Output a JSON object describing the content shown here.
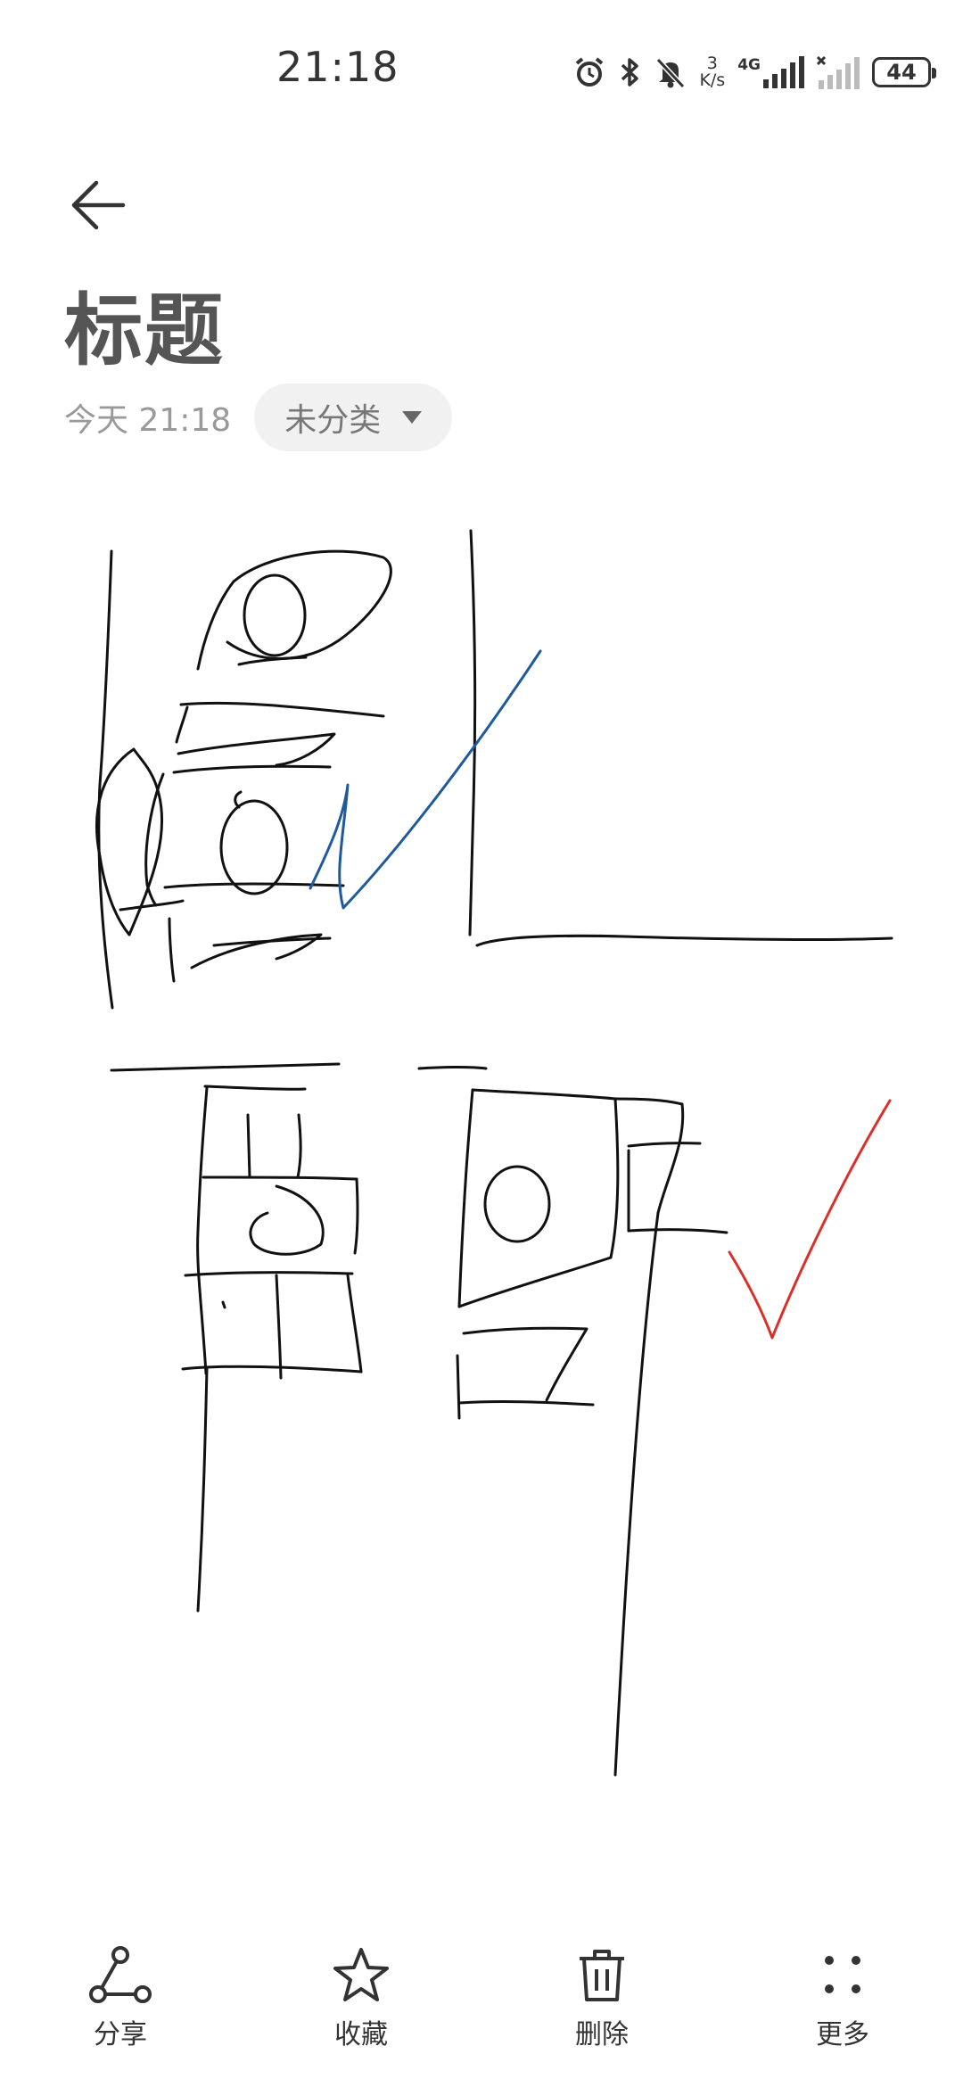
{
  "status_bar": {
    "time": "21:18",
    "net_speed_value": "3",
    "net_speed_unit": "K/s",
    "network_type": "4G",
    "battery": "44"
  },
  "note": {
    "title": "标题",
    "date": "今天 21:18",
    "category": "未分类"
  },
  "actions": [
    {
      "label": "分享",
      "icon": "share-icon"
    },
    {
      "label": "收藏",
      "icon": "star-icon"
    },
    {
      "label": "删除",
      "icon": "trash-icon"
    },
    {
      "label": "更多",
      "icon": "more-icon"
    }
  ],
  "ink_colors": {
    "black": "#111111",
    "blue": "#1e5a9c",
    "red": "#d9302b"
  }
}
